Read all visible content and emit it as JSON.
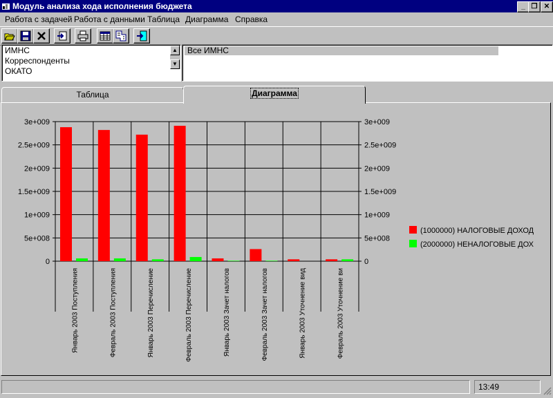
{
  "window": {
    "title": "Модуль анализа хода исполнения бюджета"
  },
  "menu": [
    "Работа с задачей",
    "Работа с данными",
    "Таблица",
    "Диаграмма",
    "Справка"
  ],
  "toolbar": [
    "open-icon",
    "save-icon",
    "delete-icon",
    "import-icon",
    "print-icon",
    "table-icon",
    "recalc-icon",
    "exit-icon"
  ],
  "left_list": {
    "items": [
      "ИМНС",
      "Корреспонденты",
      "ОКАТО"
    ]
  },
  "right_list": {
    "selected": "Все ИМНС"
  },
  "tabs": [
    {
      "label": "Таблица",
      "active": false
    },
    {
      "label": "Диаграмма",
      "active": true
    }
  ],
  "status": {
    "time": "13:49"
  },
  "chart_data": {
    "type": "bar",
    "categories": [
      "Январь 2003 Поступления",
      "Февраль 2003 Поступления",
      "Январь 2003 Перечисление",
      "Февраль 2003 Перечисление",
      "Январь 2003 Зачет налогов",
      "Февраль 2003 Зачет налогов",
      "Январь 2003 Уточнение вид",
      "Февраль 2003 Уточнение ви"
    ],
    "series": [
      {
        "name": "(1000000) НАЛОГОВЫЕ ДОХОД",
        "color": "#ff0000",
        "values": [
          2880000000,
          2820000000,
          2720000000,
          2910000000,
          60000000,
          260000000,
          40000000,
          40000000
        ]
      },
      {
        "name": "(2000000) НЕНАЛОГОВЫЕ ДОХ",
        "color": "#00ff00",
        "values": [
          60000000,
          60000000,
          40000000,
          90000000,
          10000000,
          10000000,
          0,
          40000000
        ]
      }
    ],
    "yticks": [
      "0",
      "5e+008",
      "1e+009",
      "1.5e+009",
      "2e+009",
      "2.5e+009",
      "3e+009"
    ],
    "ylim": [
      0,
      3000000000
    ],
    "grid": true,
    "legend": "right"
  }
}
